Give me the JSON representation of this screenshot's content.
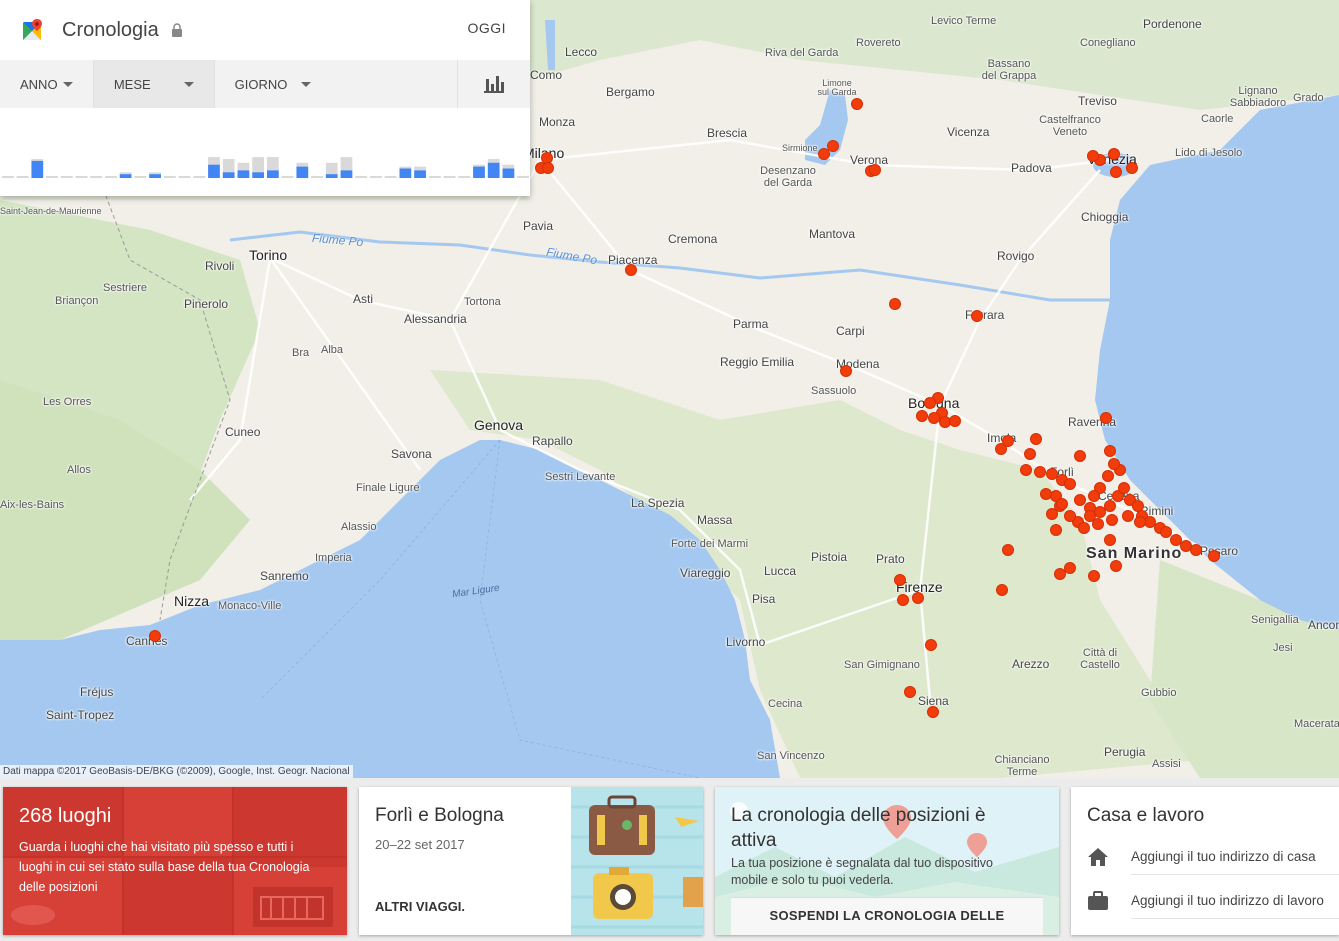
{
  "header": {
    "title": "Cronologia",
    "today_button": "OGGI"
  },
  "selectors": {
    "year": "ANNO",
    "month": "MESE",
    "day": "GIORNO"
  },
  "map": {
    "attribution": "Dati mappa ©2017 GeoBasis-DE/BKG (©2009), Google, Inst. Geogr. Nacional",
    "rivers": [
      "Fiume Po",
      "Fiume Po"
    ],
    "sea_label": "Mar Ligure",
    "cities": [
      "Milano",
      "Monza",
      "Como",
      "Lecco",
      "Bergamo",
      "Brescia",
      "Pavia",
      "Piacenza",
      "Cremona",
      "Mantova",
      "Verona",
      "Vicenza",
      "Padova",
      "Venezia",
      "Treviso",
      "Chioggia",
      "Rovigo",
      "Ferrara",
      "Parma",
      "Carpi",
      "Reggio Emilia",
      "Modena",
      "Sassuolo",
      "Bologna",
      "Imola",
      "Ravenna",
      "Forlì",
      "Cesena",
      "Rimini",
      "San Marino",
      "Pesaro",
      "Torino",
      "Rivoli",
      "Pinerolo",
      "Asti",
      "Alessandria",
      "Tortona",
      "Cuneo",
      "Savona",
      "Genova",
      "Rapallo",
      "Sestri Levante",
      "La Spezia",
      "Massa",
      "Forte dei Marmi",
      "Viareggio",
      "Lucca",
      "Pistoia",
      "Prato",
      "Firenze",
      "Pisa",
      "Livorno",
      "San Gimignano",
      "Siena",
      "Arezzo",
      "Città di Castello",
      "Gubbio",
      "Perugia",
      "Assisi",
      "Cecina",
      "San Vincenzo",
      "Chianciano Terme",
      "Nizza",
      "Monaco-Ville",
      "Cannes",
      "Fréjus",
      "Saint-Tropez",
      "Sanremo",
      "Imperia",
      "Alassio",
      "Finale Ligure",
      "Bra",
      "Alba",
      "Briançon",
      "Sestriere",
      "Les Orres",
      "Allos",
      "Rovereto",
      "Riva del Garda",
      "Limone sul Garda",
      "Sirmione",
      "Desenzano del Garda",
      "Levico Terme",
      "Bassano del Grappa",
      "Castelfranco Veneto",
      "Conegliano",
      "Pordenone",
      "Lido di Jesolo",
      "Caorle",
      "Grado",
      "Lignano Sabbiadoro",
      "Senigallia",
      "Ancona",
      "Jesi",
      "Macerata",
      "Aix-les-Bains",
      "Saint-Jean-de-Maurienne"
    ]
  },
  "cards": {
    "places": {
      "title": "268 luoghi",
      "description": "Guarda i luoghi che hai visitato più spesso e tutti i luoghi in cui sei stato sulla base della tua Cronologia delle posizioni"
    },
    "trips": {
      "title": "Forlì e Bologna",
      "dates": "20–22 set 2017",
      "more_button": "ALTRI VIAGGI."
    },
    "history": {
      "title": "La cronologia delle posizioni è attiva",
      "description": "La tua posizione è segnalata dal tuo dispositivo mobile e solo tu puoi vederla.",
      "pause_button": "SOSPENDI LA CRONOLOGIA DELLE"
    },
    "home_work": {
      "title": "Casa e lavoro",
      "home_label": "Aggiungi il tuo indirizzo di casa",
      "work_label": "Aggiungi il tuo indirizzo di lavoro"
    }
  },
  "colors": {
    "marker": "#f23c0b",
    "places_card": "#d64037",
    "chart_bar": "#4285f4",
    "chart_bar_empty": "#d9d9d9",
    "water": "#a4c8f0"
  },
  "histogram": {
    "bars": [
      0.05,
      0.05,
      0.45,
      0.05,
      0.05,
      0.05,
      0.05,
      0.05,
      0.1,
      0.05,
      0.1,
      0.05,
      0.05,
      0.05,
      0.35,
      0.15,
      0.2,
      0.15,
      0.2,
      0.05,
      0.3,
      0.05,
      0.1,
      0.2,
      0.05,
      0.05,
      0.05,
      0.25,
      0.2,
      0.05,
      0.05,
      0.05,
      0.3,
      0.4,
      0.25,
      0.05
    ],
    "bg": [
      0.05,
      0.05,
      0.5,
      0.05,
      0.05,
      0.05,
      0.05,
      0.05,
      0.15,
      0.05,
      0.15,
      0.05,
      0.05,
      0.05,
      0.55,
      0.5,
      0.4,
      0.55,
      0.55,
      0.05,
      0.4,
      0.05,
      0.4,
      0.55,
      0.05,
      0.05,
      0.05,
      0.3,
      0.3,
      0.05,
      0.05,
      0.05,
      0.35,
      0.5,
      0.35,
      0.05
    ]
  }
}
